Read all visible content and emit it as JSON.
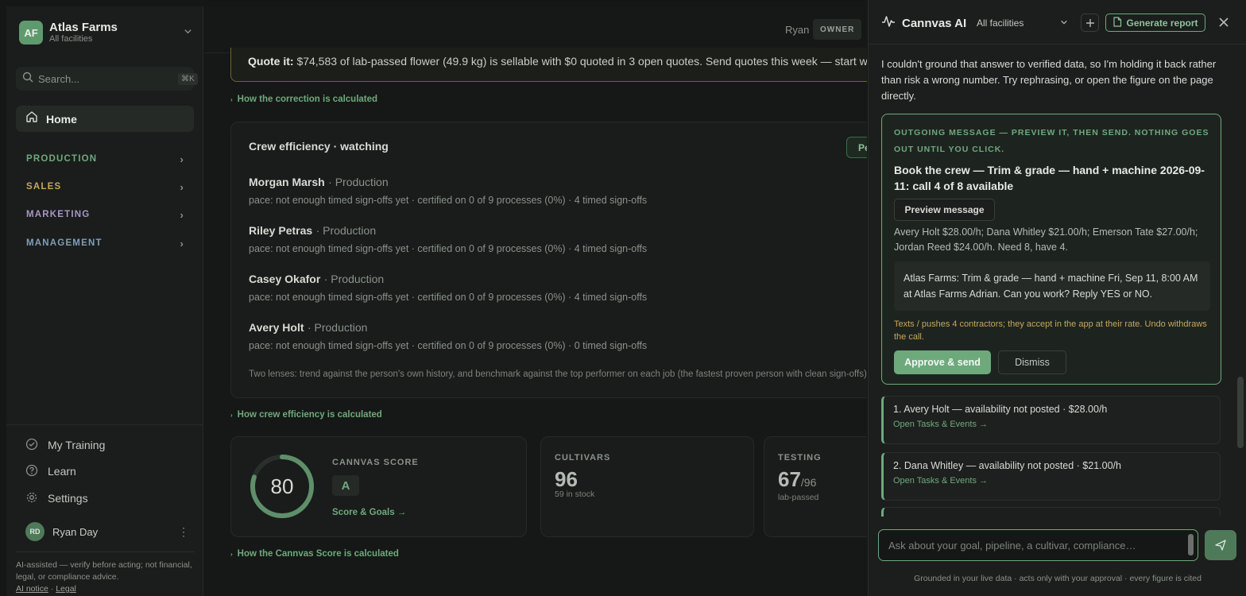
{
  "colors": {
    "accent": "#6ea97c",
    "production": "#6ea97c",
    "sales": "#c9a659",
    "marketing": "#a995c8",
    "management": "#7f9eba",
    "warning": "#c9a659"
  },
  "sidebar": {
    "org_initials": "AF",
    "org_name": "Atlas Farms",
    "org_subtitle": "All facilities",
    "search_placeholder": "Search...",
    "search_shortcut": "⌘K",
    "home_label": "Home",
    "sections": [
      {
        "label": "PRODUCTION",
        "color": "#6ea97c"
      },
      {
        "label": "SALES",
        "color": "#c9a659"
      },
      {
        "label": "MARKETING",
        "color": "#a995c8"
      },
      {
        "label": "MANAGEMENT",
        "color": "#7f9eba"
      }
    ],
    "bottom_nav": [
      {
        "label": "My Training",
        "icon": "check-circle-icon"
      },
      {
        "label": "Learn",
        "icon": "help-circle-icon"
      },
      {
        "label": "Settings",
        "icon": "gear-icon"
      }
    ],
    "user_initials": "RD",
    "user_name": "Ryan Day",
    "disclaimer": "AI-assisted — verify before acting; not financial, legal, or compliance advice.",
    "ai_notice_link": "AI notice",
    "legal_link": "Legal"
  },
  "main": {
    "user_name": "Ryan",
    "user_role": "OWNER",
    "quote_label": "Quote it:",
    "quote_text": "$74,583 of lab-passed flower (49.9 kg) is sellable with $0 quoted in 3 open quotes. Send quotes this week — start with t",
    "correction_link": "How the correction is calculated",
    "crew_title": "Crew efficiency · watching",
    "crew_button": "Pe",
    "crew": [
      {
        "name": "Morgan Marsh",
        "dept": "· Production",
        "meta": "pace: not enough timed sign-offs yet · certified on 0 of 9 processes (0%) · 4 timed sign-offs"
      },
      {
        "name": "Riley Petras",
        "dept": "· Production",
        "meta": "pace: not enough timed sign-offs yet · certified on 0 of 9 processes (0%) · 4 timed sign-offs"
      },
      {
        "name": "Casey Okafor",
        "dept": "· Production",
        "meta": "pace: not enough timed sign-offs yet · certified on 0 of 9 processes (0%) · 4 timed sign-offs"
      },
      {
        "name": "Avery Holt",
        "dept": "· Production",
        "meta": "pace: not enough timed sign-offs yet · certified on 0 of 9 processes (0%) · 0 timed sign-offs"
      }
    ],
    "crew_footnote": "Two lenses: trend against the person's own history, and benchmark against the top performer on each job (the fastest proven person with clean sign-offs)",
    "crew_link": "How crew efficiency is calculated",
    "score": {
      "value": "80",
      "fraction": 0.8,
      "kicker": "CANNVAS SCORE",
      "grade": "A",
      "link": "Score & Goals →"
    },
    "cultivars": {
      "kicker": "CULTIVARS",
      "value": "96",
      "sub": "59 in stock"
    },
    "testing": {
      "kicker": "TESTING",
      "value": "67",
      "of": "/96",
      "sub": "lab-passed"
    },
    "score_link": "How the Cannvas Score is calculated"
  },
  "panel": {
    "title": "Cannvas AI",
    "facility": "All facilities",
    "generate_label": "Generate report",
    "message": "I couldn't ground that answer to verified data, so I'm holding it back rather than risk a wrong number. Try rephrasing, or open the figure on the page directly.",
    "approval": {
      "kicker": "OUTGOING MESSAGE — PREVIEW IT, THEN SEND. NOTHING GOES OUT UNTIL YOU CLICK.",
      "title": "Book the crew — Trim & grade — hand + machine 2026-09-11: call 4 of 8 available",
      "preview_label": "Preview message",
      "rates": "Avery Holt $28.00/h; Dana Whitley $21.00/h; Emerson Tate $27.00/h; Jordan Reed $24.00/h. Need 8, have 4.",
      "sms": "Atlas Farms: Trim & grade — hand + machine Fri, Sep 11, 8:00 AM at Atlas Farms Adrian. Can you work? Reply YES or NO.",
      "warning": "Texts / pushes 4 contractors; they accept in the app at their rate. Undo withdraws the call.",
      "approve_label": "Approve & send",
      "dismiss_label": "Dismiss"
    },
    "candidates": [
      {
        "label": "1. Avery Holt — availability not posted · $28.00/h",
        "link": "Open Tasks & Events →"
      },
      {
        "label": "2. Dana Whitley — availability not posted · $21.00/h",
        "link": "Open Tasks & Events →"
      }
    ],
    "input_placeholder": "Ask about your goal, pipeline, a cultivar, compliance…",
    "footer": "Grounded in your live data · acts only with your approval · every figure is cited"
  }
}
